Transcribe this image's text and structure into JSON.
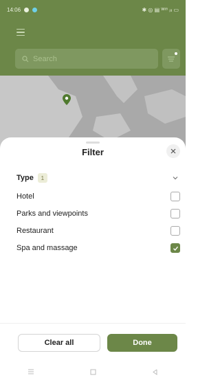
{
  "status_bar": {
    "time": "14:06",
    "icons_text": "✱ ◎ ▤ ᵂⁱᶠⁱ ᵢₗₗ ▭"
  },
  "search": {
    "placeholder": "Search"
  },
  "filter_sheet": {
    "title": "Filter",
    "section": {
      "title": "Type",
      "count": "1"
    },
    "options": [
      {
        "label": "Hotel",
        "checked": false
      },
      {
        "label": "Parks and viewpoints",
        "checked": false
      },
      {
        "label": "Restaurant",
        "checked": false
      },
      {
        "label": "Spa and massage",
        "checked": true
      }
    ],
    "clear_label": "Clear all",
    "done_label": "Done"
  },
  "colors": {
    "accent": "#6c8748",
    "map": "#a9a9a9"
  }
}
